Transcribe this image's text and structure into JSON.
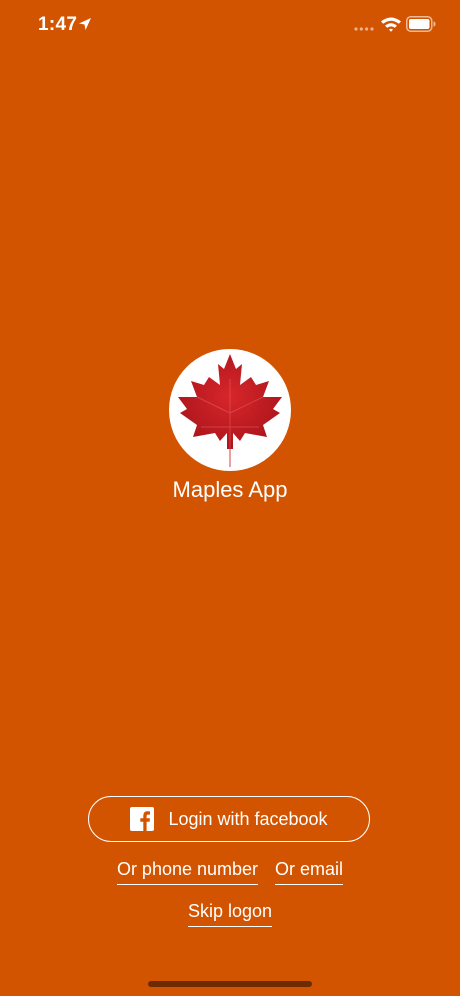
{
  "status_bar": {
    "time": "1:47",
    "location_icon": "location-arrow",
    "signal_icon": "cellular-signal",
    "wifi_icon": "wifi",
    "battery_icon": "battery-full"
  },
  "app": {
    "name": "Maples App",
    "logo_icon": "maple-leaf",
    "background_color": "#D35400",
    "leaf_color": "#C0191F"
  },
  "login": {
    "facebook_label": "Login with facebook",
    "facebook_icon": "facebook-logo",
    "phone_label": "Or phone number",
    "email_label": "Or email",
    "skip_label": "Skip logon"
  }
}
